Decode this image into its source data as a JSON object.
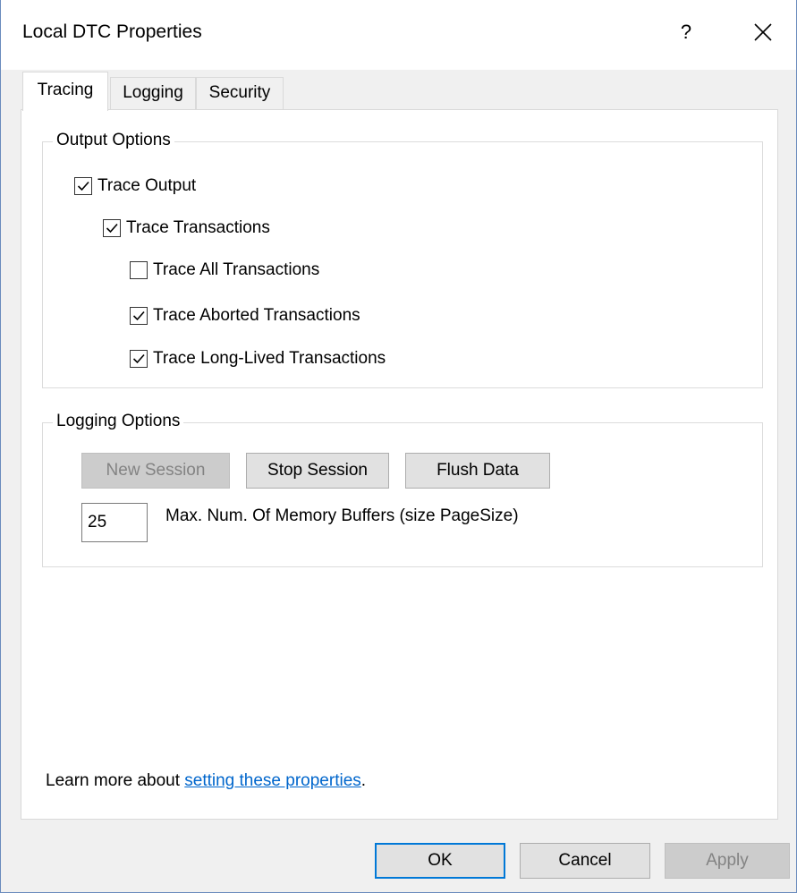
{
  "window": {
    "title": "Local DTC Properties",
    "help_glyph": "?",
    "close_icon": "close-icon"
  },
  "tabs": [
    {
      "label": "Tracing",
      "active": true
    },
    {
      "label": "Logging",
      "active": false
    },
    {
      "label": "Security",
      "active": false
    }
  ],
  "output_options": {
    "title": "Output Options",
    "items": [
      {
        "label": "Trace Output",
        "checked": true
      },
      {
        "label": "Trace Transactions",
        "checked": true
      },
      {
        "label": "Trace All Transactions",
        "checked": false
      },
      {
        "label": "Trace Aborted Transactions",
        "checked": true
      },
      {
        "label": "Trace Long-Lived Transactions",
        "checked": true
      }
    ]
  },
  "logging_options": {
    "title": "Logging Options",
    "new_session": "New Session",
    "stop_session": "Stop Session",
    "flush_data": "Flush Data",
    "buffers_value": "25",
    "buffers_label": "Max. Num. Of Memory Buffers (size PageSize)"
  },
  "footer": {
    "learn_prefix": "Learn more about ",
    "learn_link": "setting these properties",
    "learn_suffix": "."
  },
  "buttons": {
    "ok": "OK",
    "cancel": "Cancel",
    "apply": "Apply"
  },
  "colors": {
    "accent": "#0078d7",
    "link": "#0066cc",
    "window_border": "#6a8bbd"
  }
}
